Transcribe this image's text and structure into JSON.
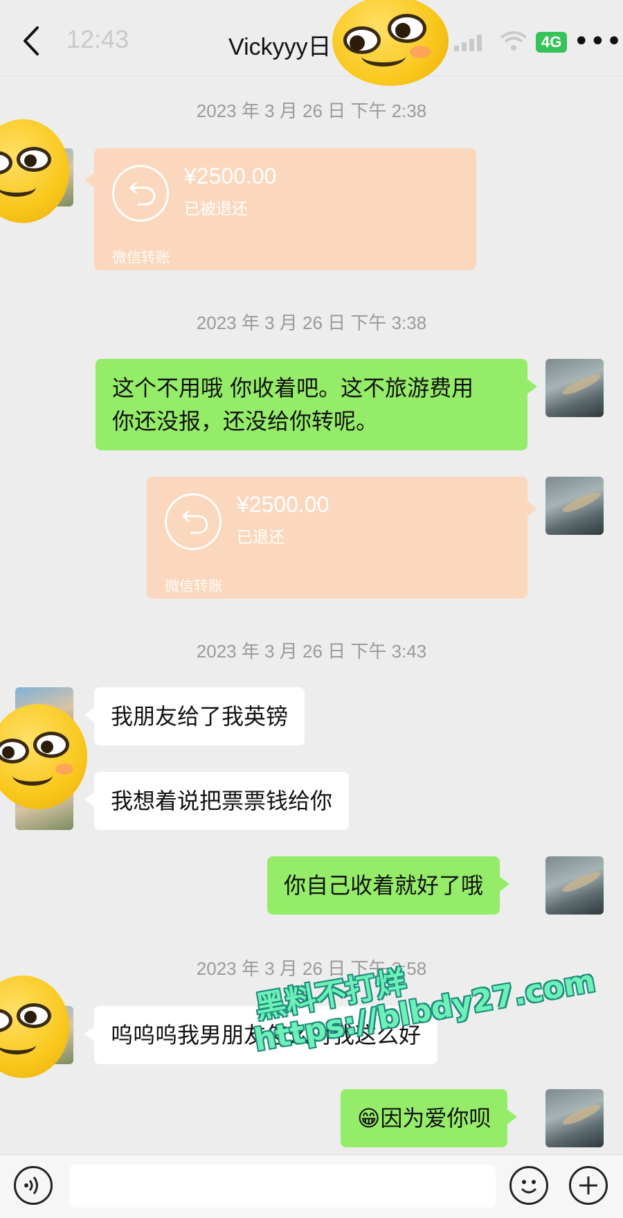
{
  "status_bar": {
    "time": "12:43",
    "network": "4G",
    "more": "•••"
  },
  "header": {
    "title": "Vickyyy日"
  },
  "messages": [
    {
      "timestamp": "2023 年 3 月 26 日  下午 2:38"
    },
    {
      "transfer": {
        "amount": "¥2500.00",
        "status": "已被退还",
        "label": "微信转账"
      }
    },
    {
      "timestamp": "2023 年 3 月 26 日  下午 3:38"
    },
    {
      "text_line1": "这个不用哦 你收着吧。这不旅游费用",
      "text_line2": "你还没报，还没给你转呢。"
    },
    {
      "transfer": {
        "amount": "¥2500.00",
        "status": "已退还",
        "label": "微信转账"
      }
    },
    {
      "timestamp": "2023 年 3 月 26 日  下午 3:43"
    },
    {
      "text": "我朋友给了我英镑"
    },
    {
      "text": "我想着说把票票钱给你"
    },
    {
      "text": "你自己收着就好了哦"
    },
    {
      "timestamp": "2023 年 3 月 26 日  下午 3:58"
    },
    {
      "text": "呜呜呜我男朋友怎么对我这么好"
    },
    {
      "emoji": "😁",
      "text": "因为爱你呗"
    }
  ],
  "watermark": {
    "line1": "黑料不打烊",
    "line2": "https://blbdy27.com"
  },
  "colors": {
    "green_bubble": "#95ec69",
    "white_bubble": "#ffffff",
    "transfer_bubble": "#fbd8bd",
    "background": "#ededed"
  },
  "icons": [
    "back-arrow-icon",
    "signal-icon",
    "wifi-icon",
    "more-icon",
    "refund-icon",
    "voice-icon",
    "emoji-icon",
    "plus-icon",
    "grinning-emoji-icon"
  ]
}
